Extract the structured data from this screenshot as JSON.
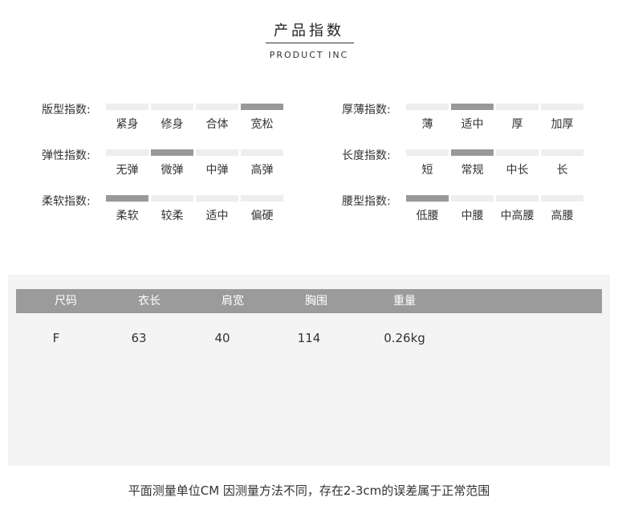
{
  "header": {
    "title": "产品指数",
    "subtitle": "PRODUCT INC"
  },
  "indices": {
    "left": [
      {
        "label": "版型指数:",
        "options": [
          "紧身",
          "修身",
          "合体",
          "宽松"
        ],
        "selected": 3
      },
      {
        "label": "弹性指数:",
        "options": [
          "无弹",
          "微弹",
          "中弹",
          "高弹"
        ],
        "selected": 1
      },
      {
        "label": "柔软指数:",
        "options": [
          "柔软",
          "较柔",
          "适中",
          "偏硬"
        ],
        "selected": 0
      }
    ],
    "right": [
      {
        "label": "厚薄指数:",
        "options": [
          "薄",
          "适中",
          "厚",
          "加厚"
        ],
        "selected": 1
      },
      {
        "label": "长度指数:",
        "options": [
          "短",
          "常规",
          "中长",
          "长"
        ],
        "selected": 1
      },
      {
        "label": "腰型指数:",
        "options": [
          "低腰",
          "中腰",
          "中高腰",
          "高腰"
        ],
        "selected": 0
      }
    ]
  },
  "size_table": {
    "headers": [
      "尺码",
      "衣长",
      "肩宽",
      "胸围",
      "重量"
    ],
    "rows": [
      [
        "F",
        "63",
        "40",
        "114",
        "0.26kg"
      ]
    ]
  },
  "footnote": "平面测量单位CM 因测量方法不同，存在2-3cm的误差属于正常范围",
  "colors": {
    "active_segment": "#999999",
    "inactive_segment": "#eeeeee",
    "table_header_bg": "#9b9b9b",
    "panel_bg": "#f4f4f4"
  }
}
